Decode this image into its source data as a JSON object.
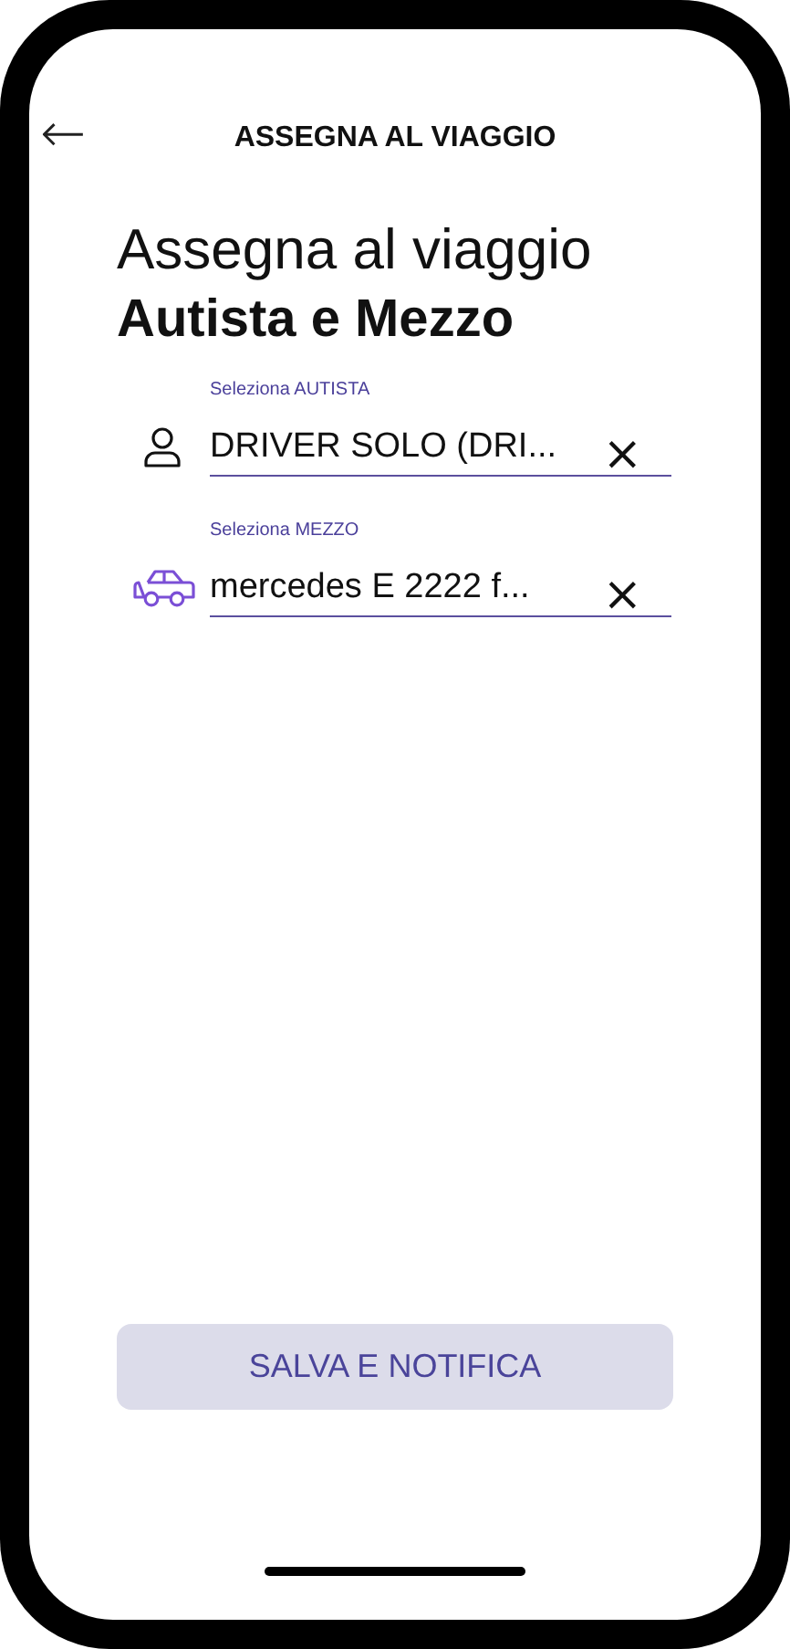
{
  "header": {
    "back_icon": "←",
    "title": "ASSEGNA AL VIAGGIO"
  },
  "heading": {
    "line_1": "Assegna al viaggio",
    "line_2": "Autista e Mezzo"
  },
  "fields": [
    {
      "kind": "person",
      "label": "Seleziona AUTISTA",
      "value": "DRIVER SOLO (DRI...",
      "clear": "×"
    },
    {
      "kind": "car",
      "label": "Seleziona MEZZO",
      "value": "mercedes E 2222 f...",
      "clear": "×"
    }
  ],
  "button": {
    "label": "SALVA E NOTIFICA",
    "disabled": true
  }
}
